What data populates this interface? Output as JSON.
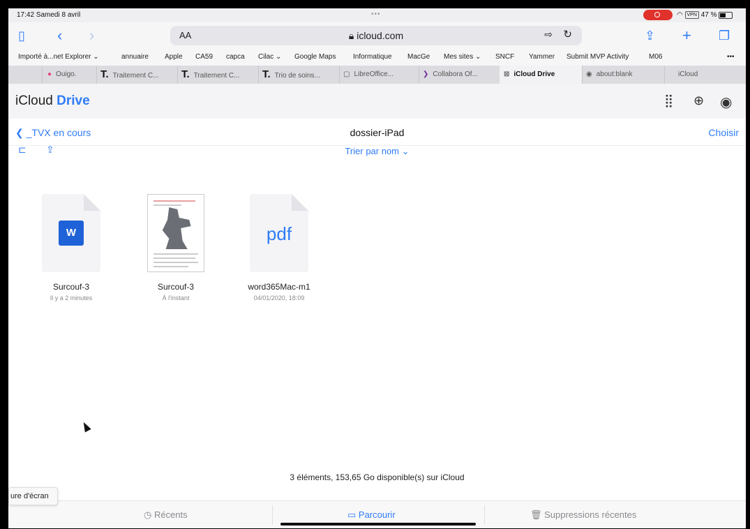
{
  "status": {
    "time": "17:42  Samedi 8 avril",
    "dots": "•••",
    "vpn": "VPN",
    "battery": "47 %"
  },
  "toolbar": {
    "aa": "AA",
    "url": "icloud.com"
  },
  "bookmarks": [
    "Importé à...net Explorer ⌄",
    "annuaire",
    "Apple",
    "CA59",
    "capca",
    "Cilac ⌄",
    "Google Maps",
    "Informatique",
    "MacGe",
    "Mes sites ⌄",
    "SNCF",
    "Yammer",
    "Submit MVP Activity",
    "M06",
    "•••"
  ],
  "tabs": [
    "Ouigo.",
    "Traitement C...",
    "Traitement C...",
    "Trio de soins...",
    "LibreOffice...",
    "Collabora Of...",
    "iCloud Drive",
    "about:blank",
    "iCloud"
  ],
  "app": {
    "apple": "",
    "title_prefix": "iCloud",
    "title_suffix": "Drive"
  },
  "nav": {
    "back": "_TVX en cours",
    "folder": "dossier-iPad",
    "choose": "Choisir"
  },
  "sort": "Trier par nom ⌄",
  "files": [
    {
      "name": "Surcouf-3",
      "date": "Il y a 2 minutes",
      "kind": "word",
      "label": "W"
    },
    {
      "name": "Surcouf-3",
      "date": "À l'instant",
      "kind": "thumbnail"
    },
    {
      "name": "word365Mac-m1",
      "date": "04/01/2020, 18:09",
      "kind": "pdf",
      "label": "pdf"
    }
  ],
  "footer": "3 éléments, 153,65 Go disponible(s) sur iCloud",
  "tooltip": "ure d'écran",
  "tabbar": {
    "recents": "Récents",
    "browse": "Parcourir",
    "deleted": "Suppressions récentes"
  },
  "colors": {
    "accent": "#2f7cf6",
    "record": "#e0322b"
  }
}
